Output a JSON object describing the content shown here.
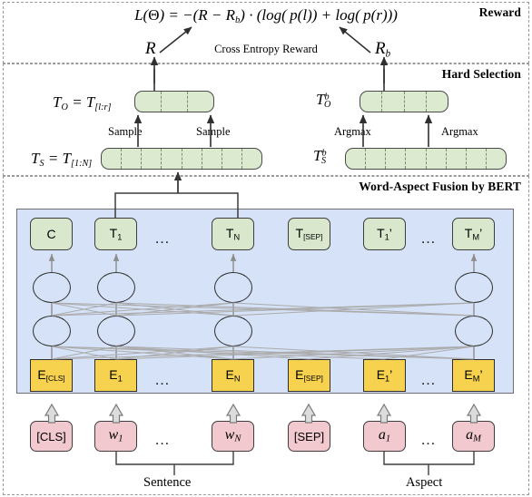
{
  "sections": [
    {
      "id": "reward",
      "title": "Reward"
    },
    {
      "id": "hard",
      "title": "Hard Selection"
    },
    {
      "id": "bert",
      "title": "Word-Aspect Fusion by BERT"
    }
  ],
  "reward": {
    "formula_plain": "L(Θ) = −(R − R_b) · (log(p(l)) + log(p(r)))",
    "cross_entropy_label": "Cross Entropy Reward",
    "r_label": "R",
    "rb_label": "R",
    "rb_sub": "b"
  },
  "hard_selection": {
    "left": {
      "output_label": "T_O = T_[l:r]",
      "source_label": "T_S = T_[1:N]",
      "op_label_left": "Sample",
      "op_label_right": "Sample",
      "output_cells": 3,
      "source_cells": 8
    },
    "right": {
      "output_label": "T_O^b",
      "source_label": "T_S^b",
      "op_label_left": "Argmax",
      "op_label_right": "Argmax",
      "output_cells": 4,
      "source_cells": 8
    }
  },
  "bert": {
    "token_outputs": [
      {
        "name": "cls-output",
        "text": "C",
        "sub": ""
      },
      {
        "name": "t1-output",
        "text": "T",
        "sub": "1"
      },
      {
        "name": "tn-output",
        "text": "T",
        "sub": "N"
      },
      {
        "name": "sep-output",
        "text": "T",
        "sub": "[SEP]"
      },
      {
        "name": "t1p-output",
        "text": "T",
        "sub": "1",
        "prime": "’"
      },
      {
        "name": "tmp-output",
        "text": "T",
        "sub": "M",
        "prime": "’"
      }
    ],
    "embeddings": [
      {
        "name": "e-cls",
        "text": "E",
        "sub": "[CLS]"
      },
      {
        "name": "e-1",
        "text": "E",
        "sub": "1"
      },
      {
        "name": "e-n",
        "text": "E",
        "sub": "N"
      },
      {
        "name": "e-sep",
        "text": "E",
        "sub": "[SEP]"
      },
      {
        "name": "e-1p",
        "text": "E",
        "sub": "1",
        "prime": "’"
      },
      {
        "name": "e-mp",
        "text": "E",
        "sub": "M",
        "prime": "’"
      }
    ],
    "inputs": [
      {
        "name": "cls-token",
        "text": "[CLS]",
        "sub": "",
        "italic": false
      },
      {
        "name": "w1-token",
        "text": "w",
        "sub": "1",
        "italic": true
      },
      {
        "name": "wn-token",
        "text": "w",
        "sub": "N",
        "italic": true
      },
      {
        "name": "sep-token",
        "text": "[SEP]",
        "sub": "",
        "italic": false
      },
      {
        "name": "a1-token",
        "text": "a",
        "sub": "1",
        "italic": true
      },
      {
        "name": "am-token",
        "text": "a",
        "sub": "M",
        "italic": true
      }
    ],
    "ellipsis": "…",
    "bracket_labels": {
      "sentence": "Sentence",
      "aspect": "Aspect"
    }
  },
  "colors": {
    "token_green": "#d9e8cd",
    "bar_green": "#dcead0",
    "embedding_yellow": "#f6d24f",
    "input_pink": "#f2c9ce",
    "panel_blue": "#d5e2f7",
    "dashed_border": "#9a9a9a",
    "arrow_gray": "#8d8d8d",
    "line_dark": "#3d3d3d"
  }
}
